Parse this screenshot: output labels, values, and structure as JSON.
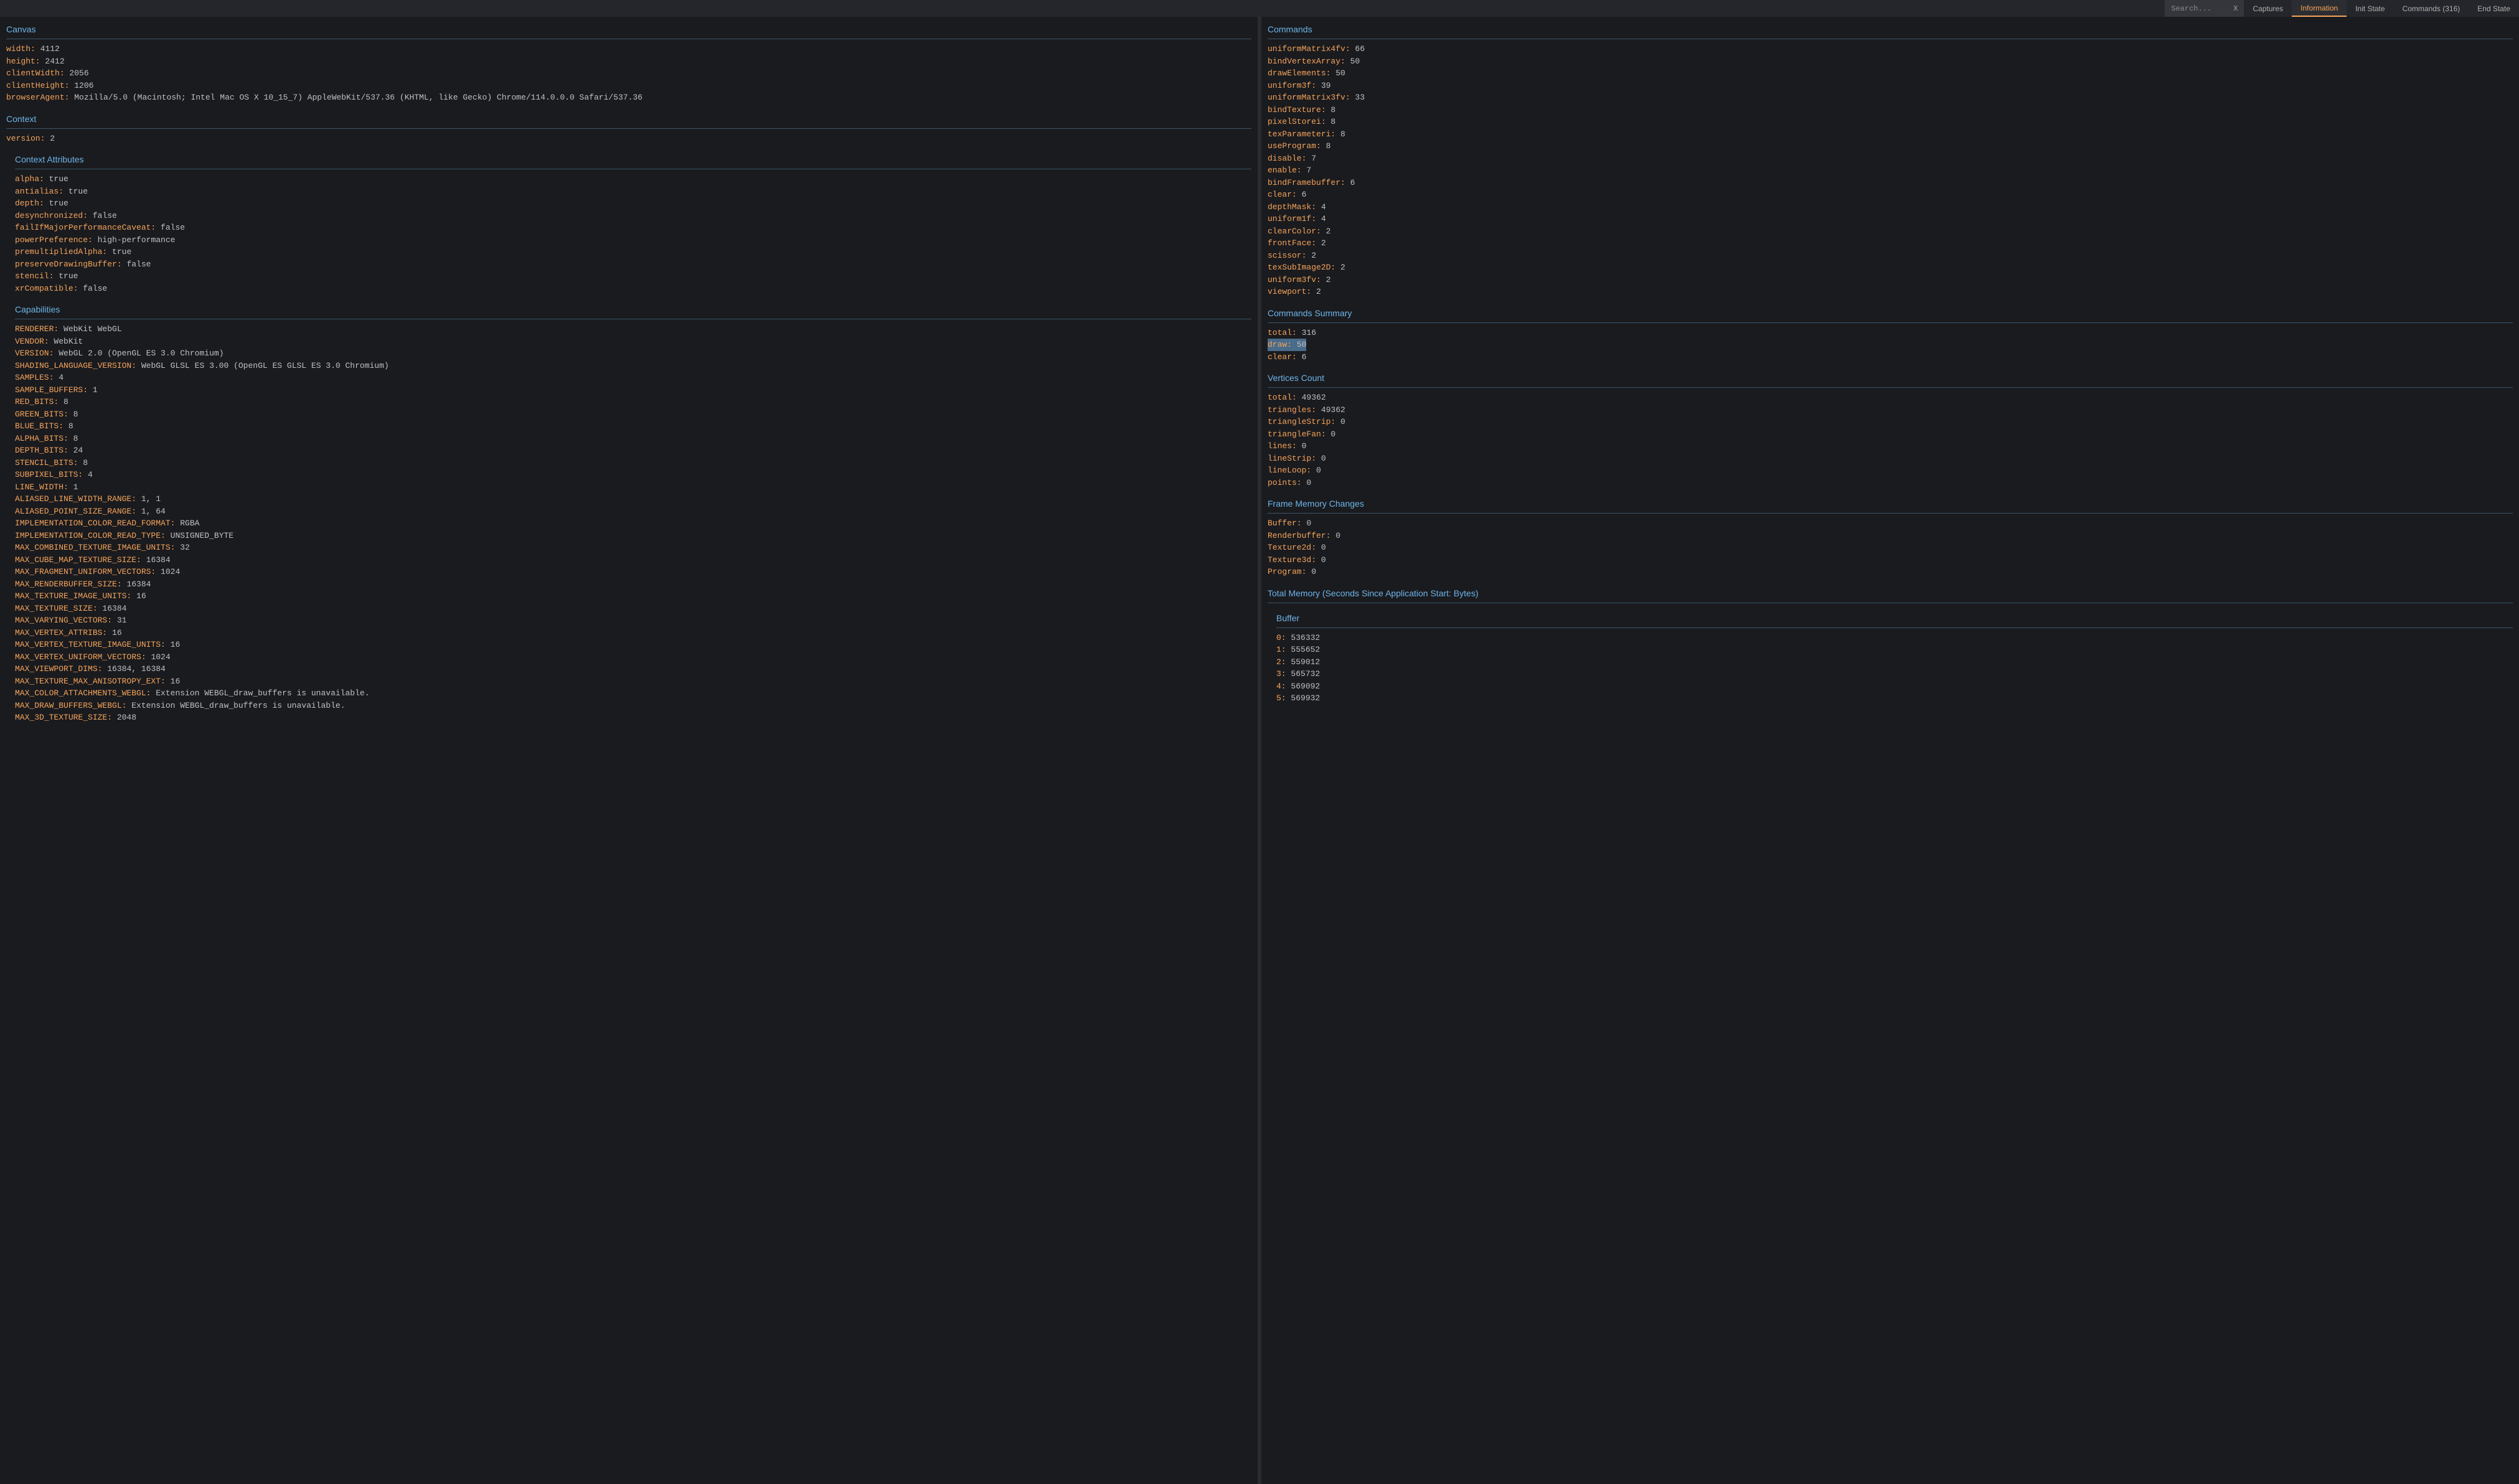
{
  "topbar": {
    "search_placeholder": "Search...",
    "search_clear": "X",
    "tabs": [
      {
        "label": "Captures",
        "active": false
      },
      {
        "label": "Information",
        "active": true
      },
      {
        "label": "Init State",
        "active": false
      },
      {
        "label": "Commands (316)",
        "active": false
      },
      {
        "label": "End State",
        "active": false
      }
    ]
  },
  "left": [
    {
      "title": "Canvas",
      "rows": [
        {
          "k": "width:",
          "v": " 4112"
        },
        {
          "k": "height:",
          "v": " 2412"
        },
        {
          "k": "clientWidth:",
          "v": " 2056"
        },
        {
          "k": "clientHeight:",
          "v": " 1206"
        },
        {
          "k": "browserAgent:",
          "v": " Mozilla/5.0 (Macintosh; Intel Mac OS X 10_15_7) AppleWebKit/537.36 (KHTML, like Gecko) Chrome/114.0.0.0 Safari/537.36"
        }
      ]
    },
    {
      "title": "Context",
      "rows": [
        {
          "k": "version:",
          "v": " 2"
        }
      ]
    },
    {
      "title": "Context Attributes",
      "indent": true,
      "rows": [
        {
          "k": "alpha:",
          "v": " true"
        },
        {
          "k": "antialias:",
          "v": " true"
        },
        {
          "k": "depth:",
          "v": " true"
        },
        {
          "k": "desynchronized:",
          "v": " false"
        },
        {
          "k": "failIfMajorPerformanceCaveat:",
          "v": " false"
        },
        {
          "k": "powerPreference:",
          "v": " high-performance"
        },
        {
          "k": "premultipliedAlpha:",
          "v": " true"
        },
        {
          "k": "preserveDrawingBuffer:",
          "v": " false"
        },
        {
          "k": "stencil:",
          "v": " true"
        },
        {
          "k": "xrCompatible:",
          "v": " false"
        }
      ]
    },
    {
      "title": "Capabilities",
      "indent": true,
      "rows": [
        {
          "k": "RENDERER:",
          "v": " WebKit WebGL"
        },
        {
          "k": "VENDOR:",
          "v": " WebKit"
        },
        {
          "k": "VERSION:",
          "v": " WebGL 2.0 (OpenGL ES 3.0 Chromium)"
        },
        {
          "k": "SHADING_LANGUAGE_VERSION:",
          "v": " WebGL GLSL ES 3.00 (OpenGL ES GLSL ES 3.0 Chromium)"
        },
        {
          "k": "SAMPLES:",
          "v": " 4"
        },
        {
          "k": "SAMPLE_BUFFERS:",
          "v": " 1"
        },
        {
          "k": "RED_BITS:",
          "v": " 8"
        },
        {
          "k": "GREEN_BITS:",
          "v": " 8"
        },
        {
          "k": "BLUE_BITS:",
          "v": " 8"
        },
        {
          "k": "ALPHA_BITS:",
          "v": " 8"
        },
        {
          "k": "DEPTH_BITS:",
          "v": " 24"
        },
        {
          "k": "STENCIL_BITS:",
          "v": " 8"
        },
        {
          "k": "SUBPIXEL_BITS:",
          "v": " 4"
        },
        {
          "k": "LINE_WIDTH:",
          "v": " 1"
        },
        {
          "k": "ALIASED_LINE_WIDTH_RANGE:",
          "v": " 1, 1"
        },
        {
          "k": "ALIASED_POINT_SIZE_RANGE:",
          "v": " 1, 64"
        },
        {
          "k": "IMPLEMENTATION_COLOR_READ_FORMAT:",
          "v": " RGBA"
        },
        {
          "k": "IMPLEMENTATION_COLOR_READ_TYPE:",
          "v": " UNSIGNED_BYTE"
        },
        {
          "k": "MAX_COMBINED_TEXTURE_IMAGE_UNITS:",
          "v": " 32"
        },
        {
          "k": "MAX_CUBE_MAP_TEXTURE_SIZE:",
          "v": " 16384"
        },
        {
          "k": "MAX_FRAGMENT_UNIFORM_VECTORS:",
          "v": " 1024"
        },
        {
          "k": "MAX_RENDERBUFFER_SIZE:",
          "v": " 16384"
        },
        {
          "k": "MAX_TEXTURE_IMAGE_UNITS:",
          "v": " 16"
        },
        {
          "k": "MAX_TEXTURE_SIZE:",
          "v": " 16384"
        },
        {
          "k": "MAX_VARYING_VECTORS:",
          "v": " 31"
        },
        {
          "k": "MAX_VERTEX_ATTRIBS:",
          "v": " 16"
        },
        {
          "k": "MAX_VERTEX_TEXTURE_IMAGE_UNITS:",
          "v": " 16"
        },
        {
          "k": "MAX_VERTEX_UNIFORM_VECTORS:",
          "v": " 1024"
        },
        {
          "k": "MAX_VIEWPORT_DIMS:",
          "v": " 16384, 16384"
        },
        {
          "k": "MAX_TEXTURE_MAX_ANISOTROPY_EXT:",
          "v": " 16"
        },
        {
          "k": "MAX_COLOR_ATTACHMENTS_WEBGL:",
          "v": " Extension WEBGL_draw_buffers is unavailable."
        },
        {
          "k": "MAX_DRAW_BUFFERS_WEBGL:",
          "v": " Extension WEBGL_draw_buffers is unavailable."
        },
        {
          "k": "MAX_3D_TEXTURE_SIZE:",
          "v": " 2048"
        }
      ]
    }
  ],
  "right": [
    {
      "title": "Commands",
      "rows": [
        {
          "k": "uniformMatrix4fv:",
          "v": " 66"
        },
        {
          "k": "bindVertexArray:",
          "v": " 50"
        },
        {
          "k": "drawElements:",
          "v": " 50"
        },
        {
          "k": "uniform3f:",
          "v": " 39"
        },
        {
          "k": "uniformMatrix3fv:",
          "v": " 33"
        },
        {
          "k": "bindTexture:",
          "v": " 8"
        },
        {
          "k": "pixelStorei:",
          "v": " 8"
        },
        {
          "k": "texParameteri:",
          "v": " 8"
        },
        {
          "k": "useProgram:",
          "v": " 8"
        },
        {
          "k": "disable:",
          "v": " 7"
        },
        {
          "k": "enable:",
          "v": " 7"
        },
        {
          "k": "bindFramebuffer:",
          "v": " 6"
        },
        {
          "k": "clear:",
          "v": " 6"
        },
        {
          "k": "depthMask:",
          "v": " 4"
        },
        {
          "k": "uniform1f:",
          "v": " 4"
        },
        {
          "k": "clearColor:",
          "v": " 2"
        },
        {
          "k": "frontFace:",
          "v": " 2"
        },
        {
          "k": "scissor:",
          "v": " 2"
        },
        {
          "k": "texSubImage2D:",
          "v": " 2"
        },
        {
          "k": "uniform3fv:",
          "v": " 2"
        },
        {
          "k": "viewport:",
          "v": " 2"
        }
      ]
    },
    {
      "title": "Commands Summary",
      "rows": [
        {
          "k": "total:",
          "v": " 316"
        },
        {
          "k": "draw:",
          "v": " 50",
          "hl": true
        },
        {
          "k": "clear:",
          "v": " 6"
        }
      ]
    },
    {
      "title": "Vertices Count",
      "rows": [
        {
          "k": "total:",
          "v": " 49362"
        },
        {
          "k": "triangles:",
          "v": " 49362"
        },
        {
          "k": "triangleStrip:",
          "v": " 0"
        },
        {
          "k": "triangleFan:",
          "v": " 0"
        },
        {
          "k": "lines:",
          "v": " 0"
        },
        {
          "k": "lineStrip:",
          "v": " 0"
        },
        {
          "k": "lineLoop:",
          "v": " 0"
        },
        {
          "k": "points:",
          "v": " 0"
        }
      ]
    },
    {
      "title": "Frame Memory Changes",
      "rows": [
        {
          "k": "Buffer:",
          "v": " 0"
        },
        {
          "k": "Renderbuffer:",
          "v": " 0"
        },
        {
          "k": "Texture2d:",
          "v": " 0"
        },
        {
          "k": "Texture3d:",
          "v": " 0"
        },
        {
          "k": "Program:",
          "v": " 0"
        }
      ]
    },
    {
      "title": "Total Memory (Seconds Since Application Start: Bytes)",
      "rows": []
    },
    {
      "title": "Buffer",
      "indent": true,
      "rows": [
        {
          "k": "0:",
          "v": " 536332"
        },
        {
          "k": "1:",
          "v": " 555652"
        },
        {
          "k": "2:",
          "v": " 559012"
        },
        {
          "k": "3:",
          "v": " 565732"
        },
        {
          "k": "4:",
          "v": " 569092"
        },
        {
          "k": "5:",
          "v": " 569932"
        }
      ]
    }
  ]
}
